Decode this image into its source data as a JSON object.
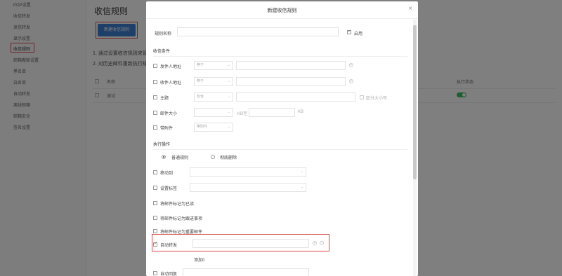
{
  "sidebar": {
    "items": [
      {
        "label": "POP设置"
      },
      {
        "label": "收信转发"
      },
      {
        "label": "发信转发"
      },
      {
        "label": "显示设置"
      },
      {
        "label": "收信规则"
      },
      {
        "label": "邮箱搬家设置"
      },
      {
        "label": "黑名单"
      },
      {
        "label": "白名单"
      },
      {
        "label": "自动转发"
      },
      {
        "label": "离线邮箱"
      },
      {
        "label": "邮箱安全"
      },
      {
        "label": "签名设置"
      }
    ],
    "active_index": 4
  },
  "main": {
    "title": "收信规则",
    "new_rule_button": "新建收信规则",
    "tips": [
      "1. 通过设置收信规则来管",
      "2. 对历史邮件重新执行规"
    ],
    "list_header": {
      "name": "名称",
      "status": "执行状态"
    },
    "rows": [
      {
        "name": "测试",
        "enabled": true
      }
    ]
  },
  "modal": {
    "title": "新建收信规则",
    "close": "×",
    "rule_name_label": "规则名称",
    "rule_name_value": "",
    "enable_label": "启用",
    "enable_checked": true,
    "conditions": {
      "title": "收信条件",
      "sender": {
        "label": "发件人地址",
        "operator": "等于"
      },
      "recipient": {
        "label": "收件人地址",
        "operator": "等于"
      },
      "subject": {
        "label": "主题",
        "operator": "包含",
        "case_label": "区分大小写"
      },
      "size": {
        "label": "邮件大小",
        "operator": "",
        "unit_mid": "KB至",
        "unit_end": "KB"
      },
      "attachment": {
        "label": "带附件",
        "operator": "带附件"
      }
    },
    "actions": {
      "title": "执行操作",
      "radio_normal": "普通规则",
      "radio_delete": "彻底删除",
      "normal_selected": true,
      "move_to": "移动到",
      "set_tag": "设置标签",
      "mark_read": "将邮件标记为已读",
      "mark_todo": "将邮件标记为跟进事项",
      "mark_important": "将邮件标记为重要邮件",
      "auto_forward": "自动转发",
      "auto_forward_checked": true,
      "add_link": "添加",
      "add_count": "0",
      "auto_reply": "自动回复"
    }
  }
}
